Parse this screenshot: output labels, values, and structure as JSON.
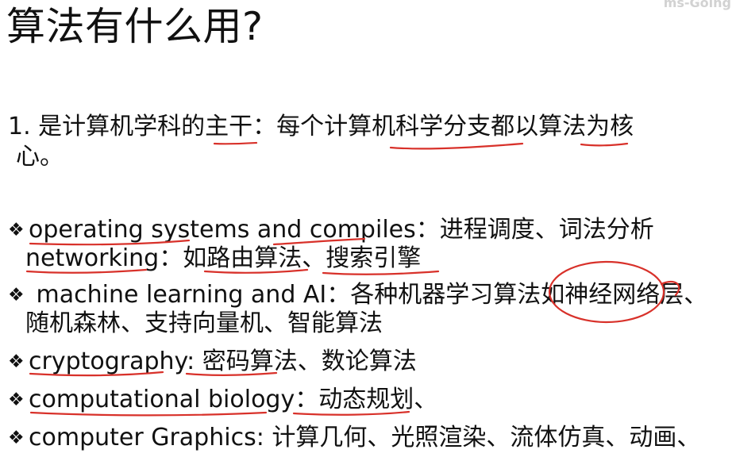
{
  "slide": {
    "title": "算法有什么用?",
    "watermark": "ms-Going",
    "point1": {
      "line1": "1. 是计算机学科的主干：每个计算机科学分支都以算法为核",
      "line2": "心。"
    },
    "bullets": [
      {
        "marker": "❖",
        "line1": "operating systems and compiles：进程调度、词法分析",
        "line2": "networking：如路由算法、搜索引擎"
      },
      {
        "marker": "❖",
        "line1": " machine learning and AI：各种机器学习算法如神经网络层、",
        "line2": "随机森林、支持向量机、智能算法"
      },
      {
        "marker": "❖",
        "line1": "cryptography: 密码算法、数论算法"
      },
      {
        "marker": "❖",
        "line1": "computational biology：动态规划、"
      },
      {
        "marker": "❖",
        "line1": "computer Graphics: 计算几何、光照渲染、流体仿真、动画、"
      }
    ],
    "annotation_color": "#d8312a"
  }
}
